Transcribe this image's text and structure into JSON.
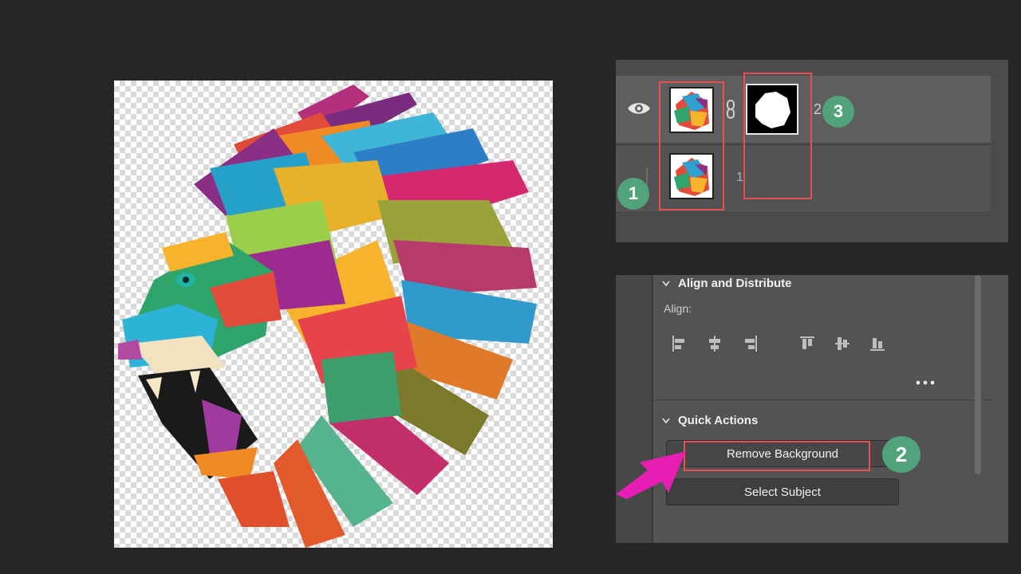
{
  "canvas": {
    "artwork": "colorful-lion-head-illustration",
    "background": "transparent-checkerboard"
  },
  "layers_panel": {
    "layers": [
      {
        "number": "2",
        "visible": true,
        "has_mask": true
      },
      {
        "number": "1",
        "visible": false,
        "has_mask": false
      }
    ]
  },
  "properties_panel": {
    "align_section": {
      "title": "Align and Distribute",
      "align_label": "Align:",
      "icons": [
        "align-left-icon",
        "align-horizontal-center-icon",
        "align-right-icon",
        "align-top-icon",
        "align-vertical-center-icon",
        "align-bottom-icon"
      ],
      "more_label": "..."
    },
    "quick_actions": {
      "title": "Quick Actions",
      "remove_background_label": "Remove Background",
      "select_subject_label": "Select Subject"
    }
  },
  "annotations": {
    "badge_1": "1",
    "badge_2": "2",
    "badge_3": "3",
    "highlight_color": "#e65050",
    "badge_color": "#52a27c",
    "arrow_color": "#e61eb4"
  }
}
